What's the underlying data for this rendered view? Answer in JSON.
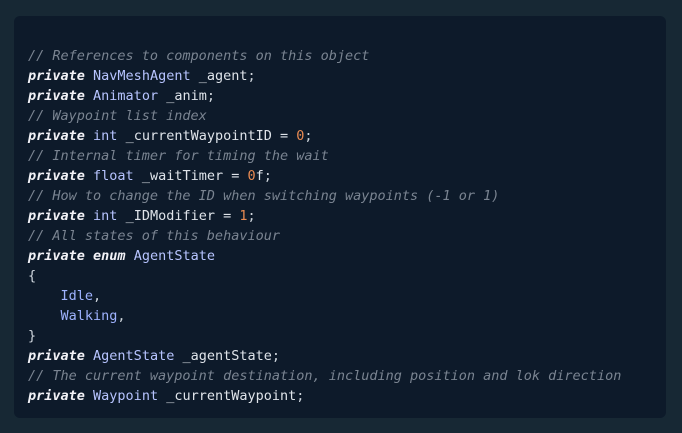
{
  "code_block": {
    "lines": [
      {
        "tokens": [
          {
            "t": "cm",
            "v": "// References to components on this object"
          }
        ]
      },
      {
        "tokens": [
          {
            "t": "kw",
            "v": "private"
          },
          {
            "t": "pun",
            "v": " "
          },
          {
            "t": "ty",
            "v": "NavMeshAgent"
          },
          {
            "t": "pun",
            "v": " "
          },
          {
            "t": "id",
            "v": "_agent"
          },
          {
            "t": "pun",
            "v": ";"
          }
        ]
      },
      {
        "tokens": [
          {
            "t": "kw",
            "v": "private"
          },
          {
            "t": "pun",
            "v": " "
          },
          {
            "t": "ty",
            "v": "Animator"
          },
          {
            "t": "pun",
            "v": " "
          },
          {
            "t": "id",
            "v": "_anim"
          },
          {
            "t": "pun",
            "v": ";"
          }
        ]
      },
      {
        "tokens": [
          {
            "t": "cm",
            "v": "// Waypoint list index"
          }
        ]
      },
      {
        "tokens": [
          {
            "t": "kw",
            "v": "private"
          },
          {
            "t": "pun",
            "v": " "
          },
          {
            "t": "ty",
            "v": "int"
          },
          {
            "t": "pun",
            "v": " "
          },
          {
            "t": "id",
            "v": "_currentWaypointID"
          },
          {
            "t": "op",
            "v": " = "
          },
          {
            "t": "num",
            "v": "0"
          },
          {
            "t": "pun",
            "v": ";"
          }
        ]
      },
      {
        "tokens": [
          {
            "t": "cm",
            "v": "// Internal timer for timing the wait"
          }
        ]
      },
      {
        "tokens": [
          {
            "t": "kw",
            "v": "private"
          },
          {
            "t": "pun",
            "v": " "
          },
          {
            "t": "ty",
            "v": "float"
          },
          {
            "t": "pun",
            "v": " "
          },
          {
            "t": "id",
            "v": "_waitTimer"
          },
          {
            "t": "op",
            "v": " = "
          },
          {
            "t": "num",
            "v": "0"
          },
          {
            "t": "id",
            "v": "f"
          },
          {
            "t": "pun",
            "v": ";"
          }
        ]
      },
      {
        "tokens": [
          {
            "t": "cm",
            "v": "// How to change the ID when switching waypoints (-1 or 1)"
          }
        ]
      },
      {
        "tokens": [
          {
            "t": "kw",
            "v": "private"
          },
          {
            "t": "pun",
            "v": " "
          },
          {
            "t": "ty",
            "v": "int"
          },
          {
            "t": "pun",
            "v": " "
          },
          {
            "t": "id",
            "v": "_IDModifier"
          },
          {
            "t": "op",
            "v": " = "
          },
          {
            "t": "num",
            "v": "1"
          },
          {
            "t": "pun",
            "v": ";"
          }
        ]
      },
      {
        "tokens": [
          {
            "t": "cm",
            "v": "// All states of this behaviour"
          }
        ]
      },
      {
        "tokens": [
          {
            "t": "kw",
            "v": "private"
          },
          {
            "t": "pun",
            "v": " "
          },
          {
            "t": "kw",
            "v": "enum"
          },
          {
            "t": "pun",
            "v": " "
          },
          {
            "t": "ty",
            "v": "AgentState"
          }
        ]
      },
      {
        "tokens": [
          {
            "t": "pun",
            "v": "{"
          }
        ]
      },
      {
        "tokens": [
          {
            "t": "pun",
            "v": "    "
          },
          {
            "t": "mem",
            "v": "Idle"
          },
          {
            "t": "pun",
            "v": ","
          }
        ]
      },
      {
        "tokens": [
          {
            "t": "pun",
            "v": "    "
          },
          {
            "t": "mem",
            "v": "Walking"
          },
          {
            "t": "pun",
            "v": ","
          }
        ]
      },
      {
        "tokens": [
          {
            "t": "pun",
            "v": "}"
          }
        ]
      },
      {
        "tokens": [
          {
            "t": "kw",
            "v": "private"
          },
          {
            "t": "pun",
            "v": " "
          },
          {
            "t": "ty",
            "v": "AgentState"
          },
          {
            "t": "pun",
            "v": " "
          },
          {
            "t": "id",
            "v": "_agentState"
          },
          {
            "t": "pun",
            "v": ";"
          }
        ]
      },
      {
        "tokens": [
          {
            "t": "cm",
            "v": "// The current waypoint destination, including position and lok direction"
          }
        ]
      },
      {
        "tokens": [
          {
            "t": "kw",
            "v": "private"
          },
          {
            "t": "pun",
            "v": " "
          },
          {
            "t": "ty",
            "v": "Waypoint"
          },
          {
            "t": "pun",
            "v": " "
          },
          {
            "t": "id",
            "v": "_currentWaypoint"
          },
          {
            "t": "pun",
            "v": ";"
          }
        ]
      }
    ]
  }
}
